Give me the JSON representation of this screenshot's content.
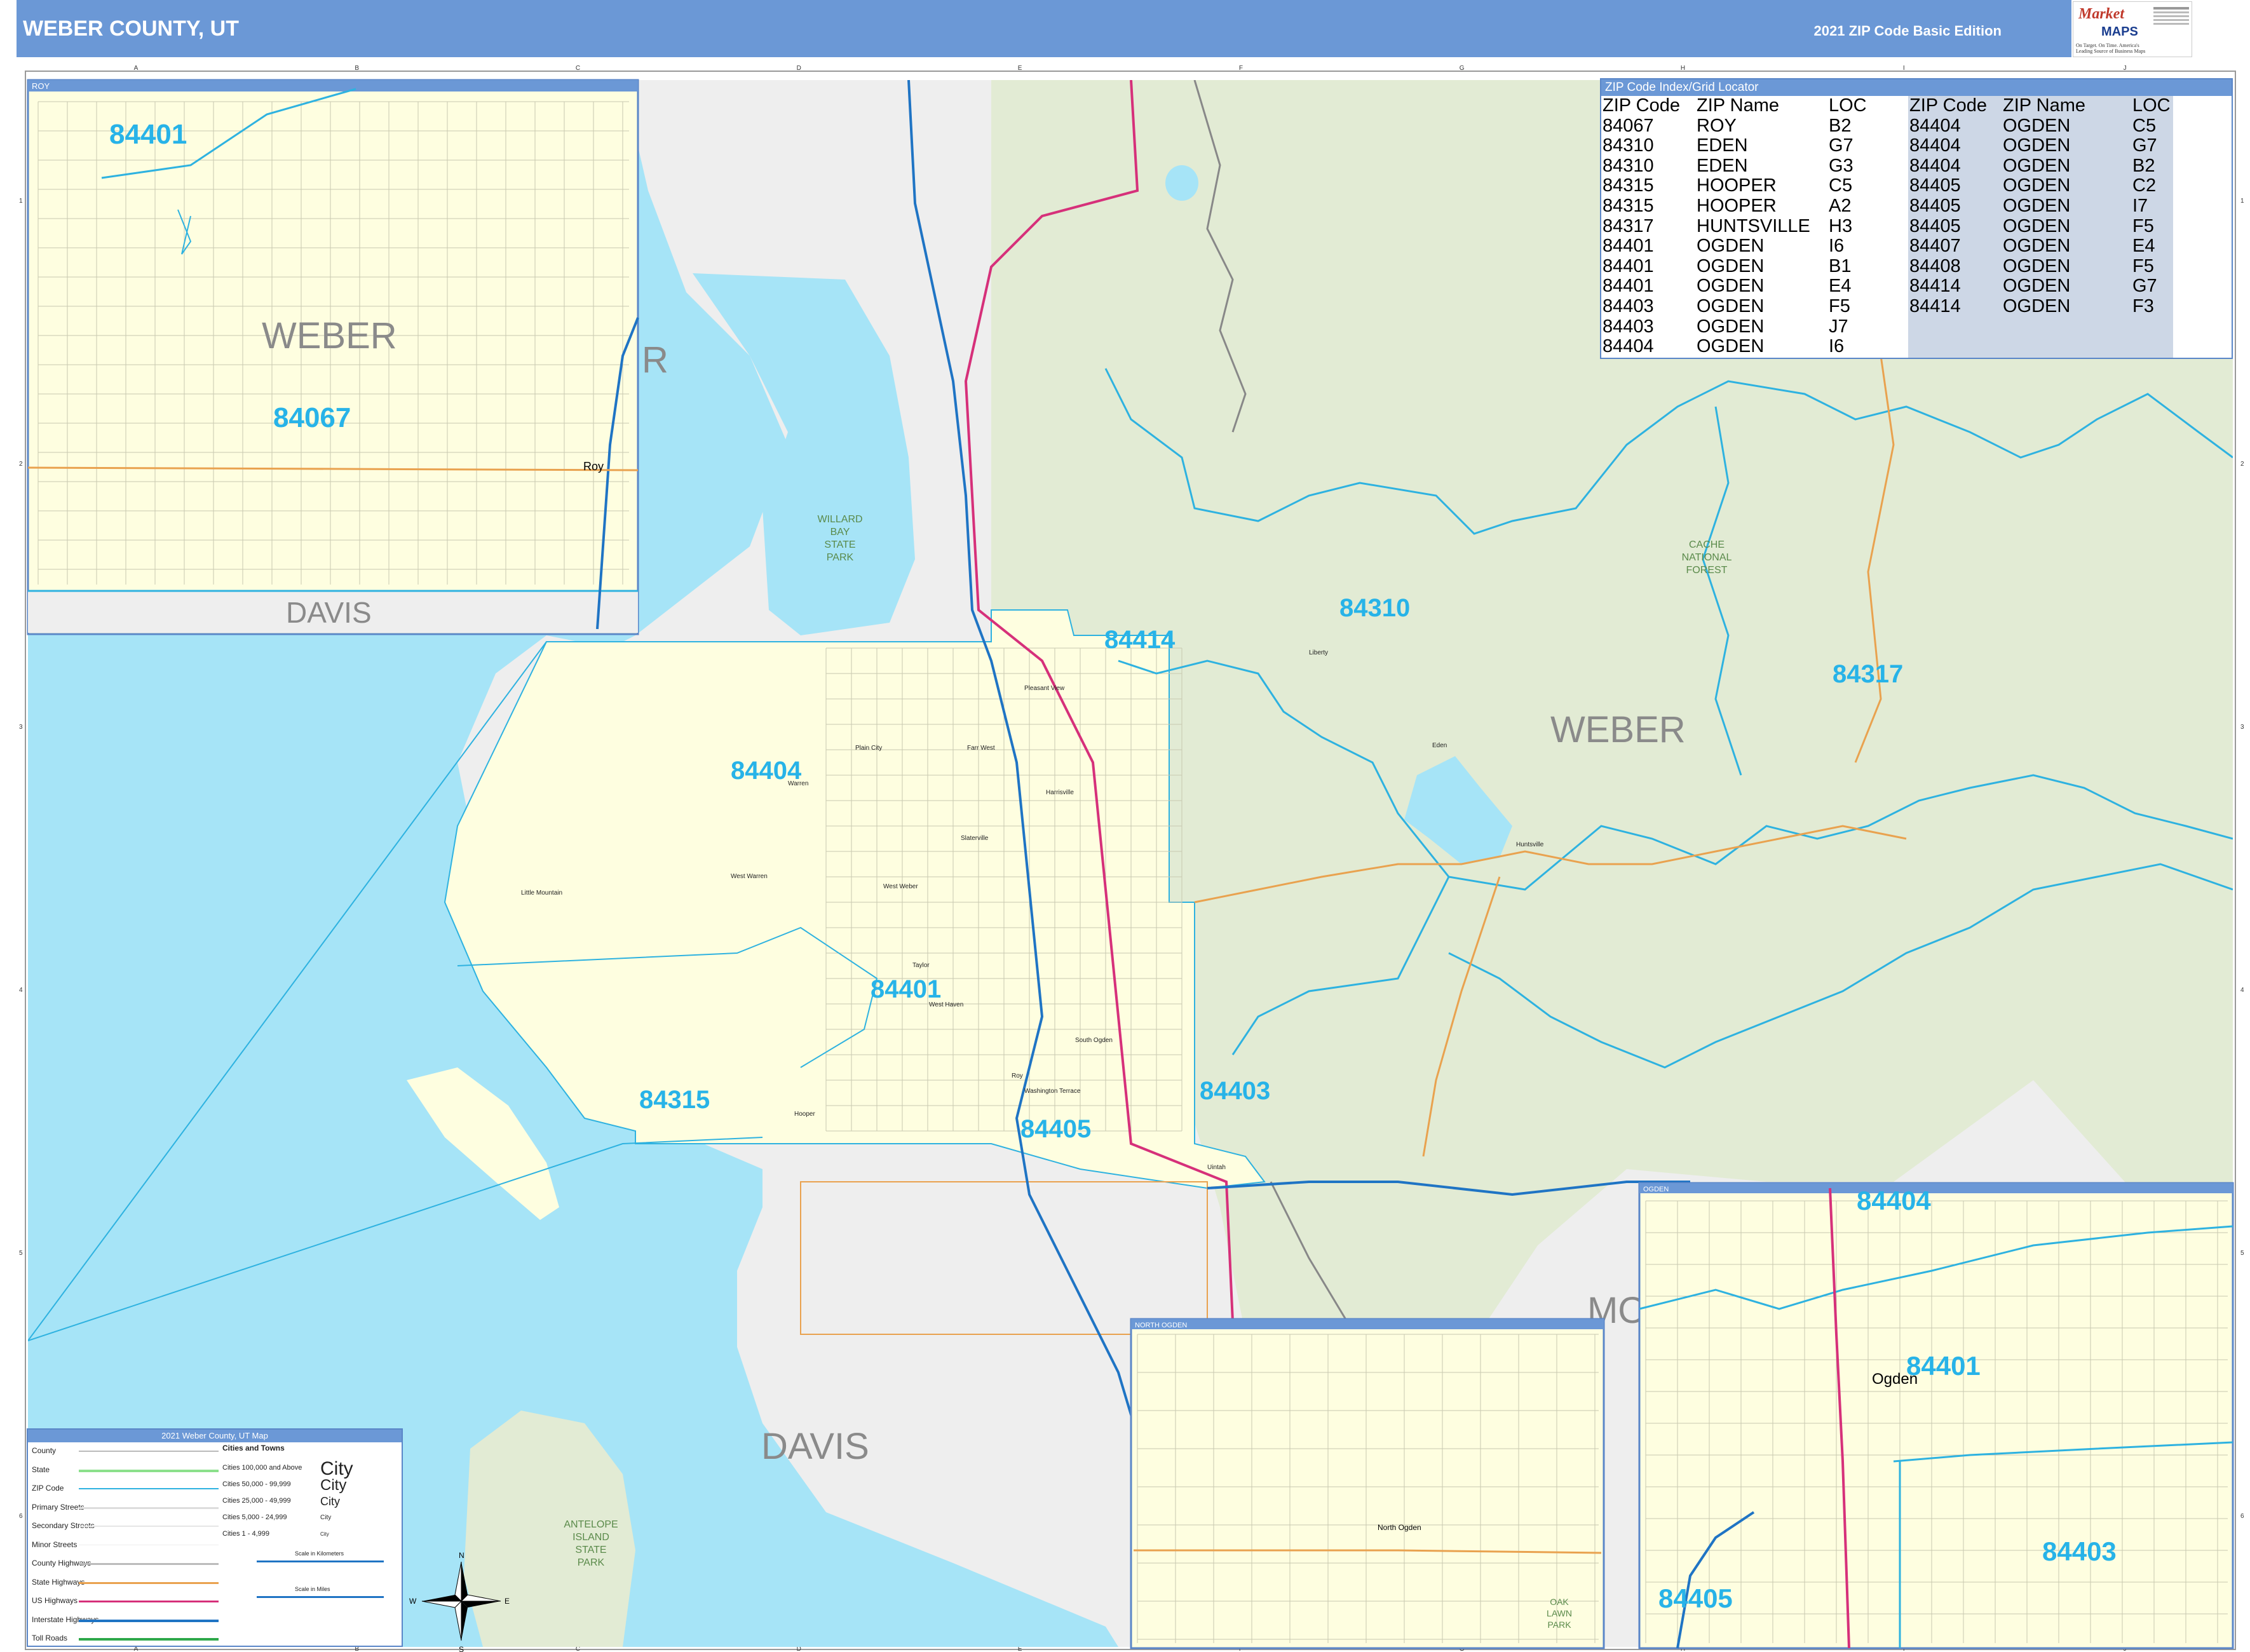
{
  "header": {
    "title": "WEBER COUNTY, UT",
    "edition": "2021 ZIP Code Basic Edition"
  },
  "brand": {
    "logo_text": "Market",
    "maps_text": "MAPS",
    "tagline": "On Target. On Time. America's Leading Source of Business Maps"
  },
  "colors": {
    "header_bg": "#6b98d6",
    "water": "#a6e4f7",
    "forest": "#e2ebd4",
    "county_fill": "#fefee0",
    "outside_fill": "#eeeeee",
    "zip_boundary": "#2eb2e0",
    "interstate": "#1f74c4",
    "us_highway": "#d6307a",
    "state_highway": "#e9a24f",
    "zip_label": "#27b3e8"
  },
  "grid": {
    "columns": [
      "A",
      "B",
      "C",
      "D",
      "E",
      "F",
      "G",
      "H",
      "I",
      "J"
    ],
    "rows": [
      "1",
      "2",
      "3",
      "4",
      "5",
      "6"
    ]
  },
  "zip_index": {
    "title": "ZIP Code Index/Grid Locator",
    "headers": [
      "ZIP Code",
      "ZIP Name",
      "LOC",
      "ZIP Code",
      "ZIP Name",
      "LOC"
    ],
    "left": [
      [
        "84067",
        "ROY",
        "B2"
      ],
      [
        "84310",
        "EDEN",
        "G7"
      ],
      [
        "84310",
        "EDEN",
        "G3"
      ],
      [
        "84315",
        "HOOPER",
        "C5"
      ],
      [
        "84315",
        "HOOPER",
        "A2"
      ],
      [
        "84317",
        "HUNTSVILLE",
        "H3"
      ],
      [
        "84401",
        "OGDEN",
        "I6"
      ],
      [
        "84401",
        "OGDEN",
        "B1"
      ],
      [
        "84401",
        "OGDEN",
        "E4"
      ],
      [
        "84403",
        "OGDEN",
        "F5"
      ],
      [
        "84403",
        "OGDEN",
        "J7"
      ],
      [
        "84404",
        "OGDEN",
        "I6"
      ]
    ],
    "right": [
      [
        "84404",
        "OGDEN",
        "C5"
      ],
      [
        "84404",
        "OGDEN",
        "G7"
      ],
      [
        "84404",
        "OGDEN",
        "B2"
      ],
      [
        "84405",
        "OGDEN",
        "C2"
      ],
      [
        "84405",
        "OGDEN",
        "I7"
      ],
      [
        "84405",
        "OGDEN",
        "F5"
      ],
      [
        "84407",
        "OGDEN",
        "E4"
      ],
      [
        "84408",
        "OGDEN",
        "F5"
      ],
      [
        "84414",
        "OGDEN",
        "G7"
      ],
      [
        "84414",
        "OGDEN",
        "F3"
      ]
    ]
  },
  "main_map": {
    "zip_labels": [
      {
        "id": "84414",
        "text": "84414"
      },
      {
        "id": "84310",
        "text": "84310"
      },
      {
        "id": "84317",
        "text": "84317"
      },
      {
        "id": "84404",
        "text": "84404"
      },
      {
        "id": "84401",
        "text": "84401"
      },
      {
        "id": "84403",
        "text": "84403"
      },
      {
        "id": "84315",
        "text": "84315"
      },
      {
        "id": "84405",
        "text": "84405"
      }
    ],
    "county_labels": [
      {
        "id": "weber",
        "text": "WEBER"
      },
      {
        "id": "davis",
        "text": "DAVIS"
      },
      {
        "id": "morgan",
        "text": "MO"
      },
      {
        "id": "box-elder",
        "text": "R"
      }
    ],
    "park_labels": [
      {
        "id": "willard",
        "lines": [
          "WILLARD",
          "BAY",
          "STATE",
          "PARK"
        ]
      },
      {
        "id": "cache",
        "lines": [
          "CACHE",
          "NATIONAL",
          "FOREST"
        ]
      },
      {
        "id": "antelope",
        "lines": [
          "ANTELOPE",
          "ISLAND",
          "STATE",
          "PARK"
        ]
      }
    ],
    "place_labels": [
      {
        "id": "pleasant-view",
        "text": "Pleasant View"
      },
      {
        "id": "farr-west",
        "text": "Farr West"
      },
      {
        "id": "plain-city",
        "text": "Plain City"
      },
      {
        "id": "harrisville",
        "text": "Harrisville"
      },
      {
        "id": "marriott-slaterville",
        "text": "Slaterville"
      },
      {
        "id": "west-weber",
        "text": "West Weber"
      },
      {
        "id": "west-warren",
        "text": "West Warren"
      },
      {
        "id": "warren",
        "text": "Warren"
      },
      {
        "id": "little-mountain",
        "text": "Little Mountain"
      },
      {
        "id": "taylor",
        "text": "Taylor"
      },
      {
        "id": "west-haven",
        "text": "West Haven"
      },
      {
        "id": "south-ogden",
        "text": "South Ogden"
      },
      {
        "id": "washington-terrace",
        "text": "Washington Terrace"
      },
      {
        "id": "roy-main",
        "text": "Roy"
      },
      {
        "id": "hooper",
        "text": "Hooper"
      },
      {
        "id": "eden",
        "text": "Eden"
      },
      {
        "id": "liberty",
        "text": "Liberty"
      },
      {
        "id": "huntsville",
        "text": "Huntsville"
      },
      {
        "id": "uintah",
        "text": "Uintah"
      }
    ]
  },
  "inset_roy": {
    "header": "ROY",
    "labels": [
      {
        "id": "84401",
        "text": "84401"
      },
      {
        "id": "84067",
        "text": "84067"
      },
      {
        "id": "weber",
        "text": "WEBER"
      },
      {
        "id": "davis",
        "text": "DAVIS"
      },
      {
        "id": "roy",
        "text": "Roy"
      }
    ]
  },
  "inset_north_ogden": {
    "header": "NORTH OGDEN",
    "labels": [
      {
        "id": "north-ogden",
        "text": "North Ogden"
      },
      {
        "id": "oak-lawn",
        "lines": [
          "OAK",
          "LAWN",
          "PARK"
        ]
      }
    ]
  },
  "inset_ogden": {
    "header": "OGDEN",
    "labels": [
      {
        "id": "84404",
        "text": "84404"
      },
      {
        "id": "84401",
        "text": "84401"
      },
      {
        "id": "84403",
        "text": "84403"
      },
      {
        "id": "84405",
        "text": "84405"
      },
      {
        "id": "ogden",
        "text": "Ogden"
      }
    ]
  },
  "legend": {
    "title": "2021 Weber County, UT Map",
    "items": [
      "County",
      "State",
      "ZIP Code",
      "Primary Streets",
      "Secondary Streets",
      "Minor Streets",
      "County Highways",
      "State Highways",
      "US Highways",
      "Interstate Highways",
      "Toll Roads"
    ],
    "cities_title": "Cities and Towns",
    "city_classes": [
      "Cities 100,000 and Above",
      "Cities 50,000 - 99,999",
      "Cities 25,000 - 49,999",
      "Cities 5,000 - 24,999",
      "Cities 1 - 4,999"
    ],
    "city_samples": [
      "City",
      "City",
      "City",
      "City",
      "City"
    ],
    "scale_km": "Scale in Kilometers",
    "scale_mi": "Scale in Miles"
  },
  "compass": {
    "n": "N",
    "s": "S",
    "e": "E",
    "w": "W"
  }
}
